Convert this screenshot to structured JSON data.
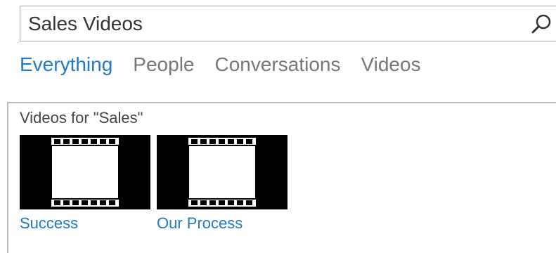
{
  "search": {
    "query": "Sales Videos",
    "icon": "search-icon"
  },
  "tabs": [
    {
      "label": "Everything",
      "active": true
    },
    {
      "label": "People",
      "active": false
    },
    {
      "label": "Conversations",
      "active": false
    },
    {
      "label": "Videos",
      "active": false
    }
  ],
  "results": {
    "heading": "Videos for \"Sales\"",
    "videos": [
      {
        "title": "Success",
        "thumbnail_icon": "film-strip-icon"
      },
      {
        "title": "Our Process",
        "thumbnail_icon": "film-strip-icon"
      }
    ]
  },
  "colors": {
    "accent": "#1f7ac3",
    "tab_inactive": "#777777",
    "border": "#a8a8a8"
  }
}
